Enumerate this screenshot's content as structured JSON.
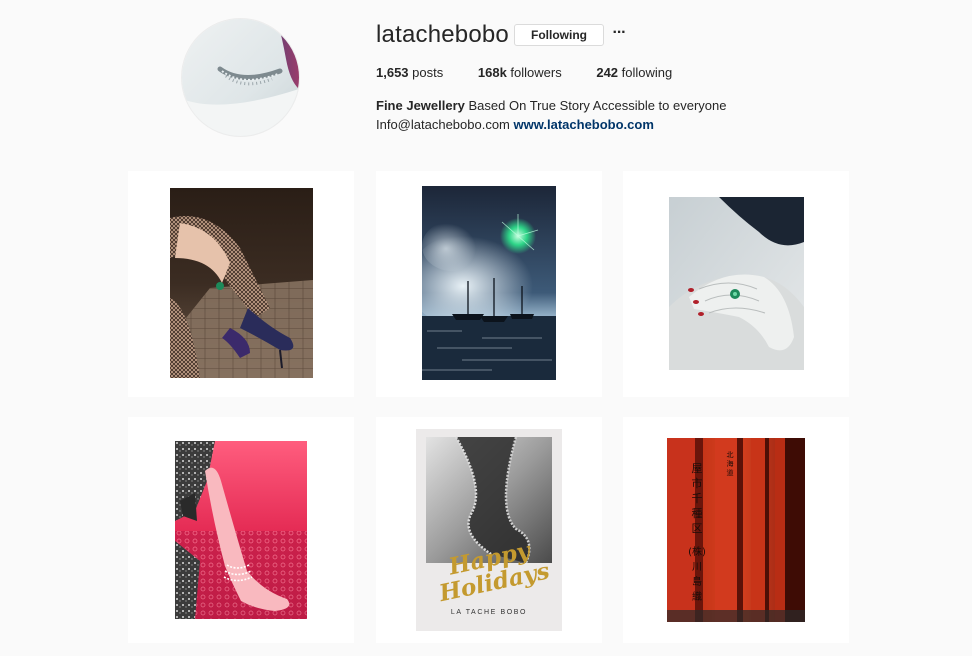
{
  "profile": {
    "username": "latachebobo",
    "follow_button": "Following",
    "more_icon": "···",
    "stats": {
      "posts_count": "1,653",
      "posts_label": "posts",
      "followers_count": "168k",
      "followers_label": "followers",
      "following_count": "242",
      "following_label": "following"
    },
    "bio": {
      "name": "Fine Jewellery",
      "text": "Based On True Story Accessible to everyone",
      "email": "Info@latachebobo.com",
      "website": "www.latachebobo.com"
    }
  },
  "posts": [
    {
      "image": "legs-heels-emerald-ring"
    },
    {
      "image": "fireworks-harbor"
    },
    {
      "image": "hand-emerald-ring"
    },
    {
      "image": "red-diamond-anklet"
    },
    {
      "image": "happy-holidays-card",
      "caption": "Happy Holidays",
      "brand": "LA TACHE BOBO"
    },
    {
      "image": "torii-gates",
      "glyphs": [
        "屋",
        "市",
        "千",
        "種",
        "区",
        "(株)",
        "川",
        "島",
        "織",
        "北",
        "海",
        "道"
      ]
    }
  ],
  "colors": {
    "link": "#003569",
    "background": "#fafafa",
    "border": "#dbdbdb",
    "torii": "#c8321c"
  }
}
